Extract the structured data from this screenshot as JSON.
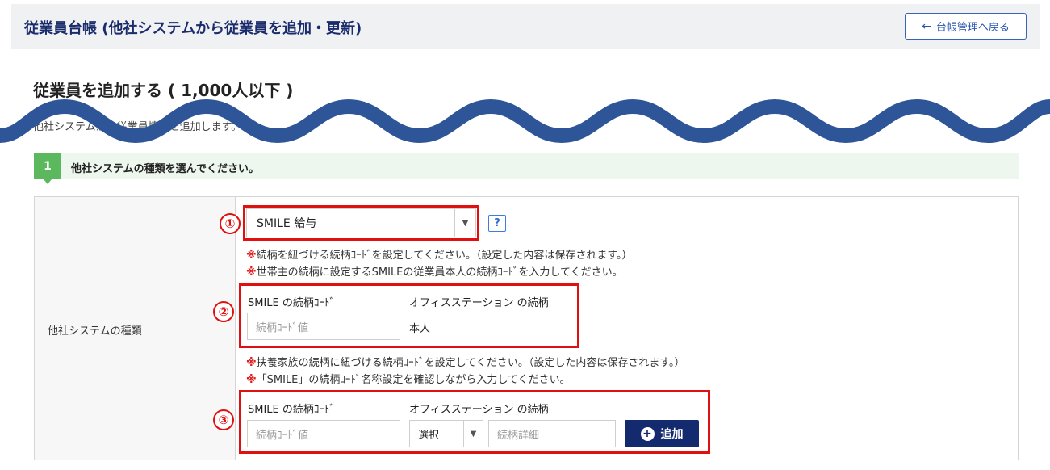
{
  "header": {
    "title": "従業員台帳 (他社システムから従業員を追加・更新)",
    "back_label": "台帳管理へ戻る"
  },
  "section": {
    "title": "従業員を追加する ( 1,000人以下 )",
    "description": "他社システムから従業員情報を追加します。"
  },
  "step": {
    "number": "1",
    "text": "他社システムの種類を選んでください。"
  },
  "form": {
    "row_label": "他社システムの種類",
    "system_select_value": "SMILE 給与",
    "help_label": "?",
    "note_mark": "※",
    "notes_self": [
      "続柄を紐づける続柄ｺｰﾄﾞを設定してください。（設定した内容は保存されます。）",
      "世帯主の続柄に設定するSMILEの従業員本人の続柄ｺｰﾄﾞを入力してください。"
    ],
    "self_block": {
      "code_label": "SMILE の続柄ｺｰﾄﾞ",
      "code_placeholder": "続柄ｺｰﾄﾞ値",
      "relation_label": "オフィスステーション の続柄",
      "relation_value": "本人"
    },
    "notes_family": [
      "扶養家族の続柄に紐づける続柄ｺｰﾄﾞを設定してください。（設定した内容は保存されます。）",
      "「SMILE」の続柄ｺｰﾄﾞ名称設定を確認しながら入力してください。"
    ],
    "family_block": {
      "code_label": "SMILE の続柄ｺｰﾄﾞ",
      "code_placeholder": "続柄ｺｰﾄﾞ値",
      "relation_label": "オフィスステーション の続柄",
      "relation_select_value": "選択",
      "detail_placeholder": "続柄詳細",
      "add_label": "追加"
    }
  },
  "annotations": [
    "①",
    "②",
    "③"
  ],
  "colors": {
    "accent": "#132a6e",
    "highlight": "#e01010",
    "step": "#5cb85c",
    "wave": "#2e5597"
  }
}
